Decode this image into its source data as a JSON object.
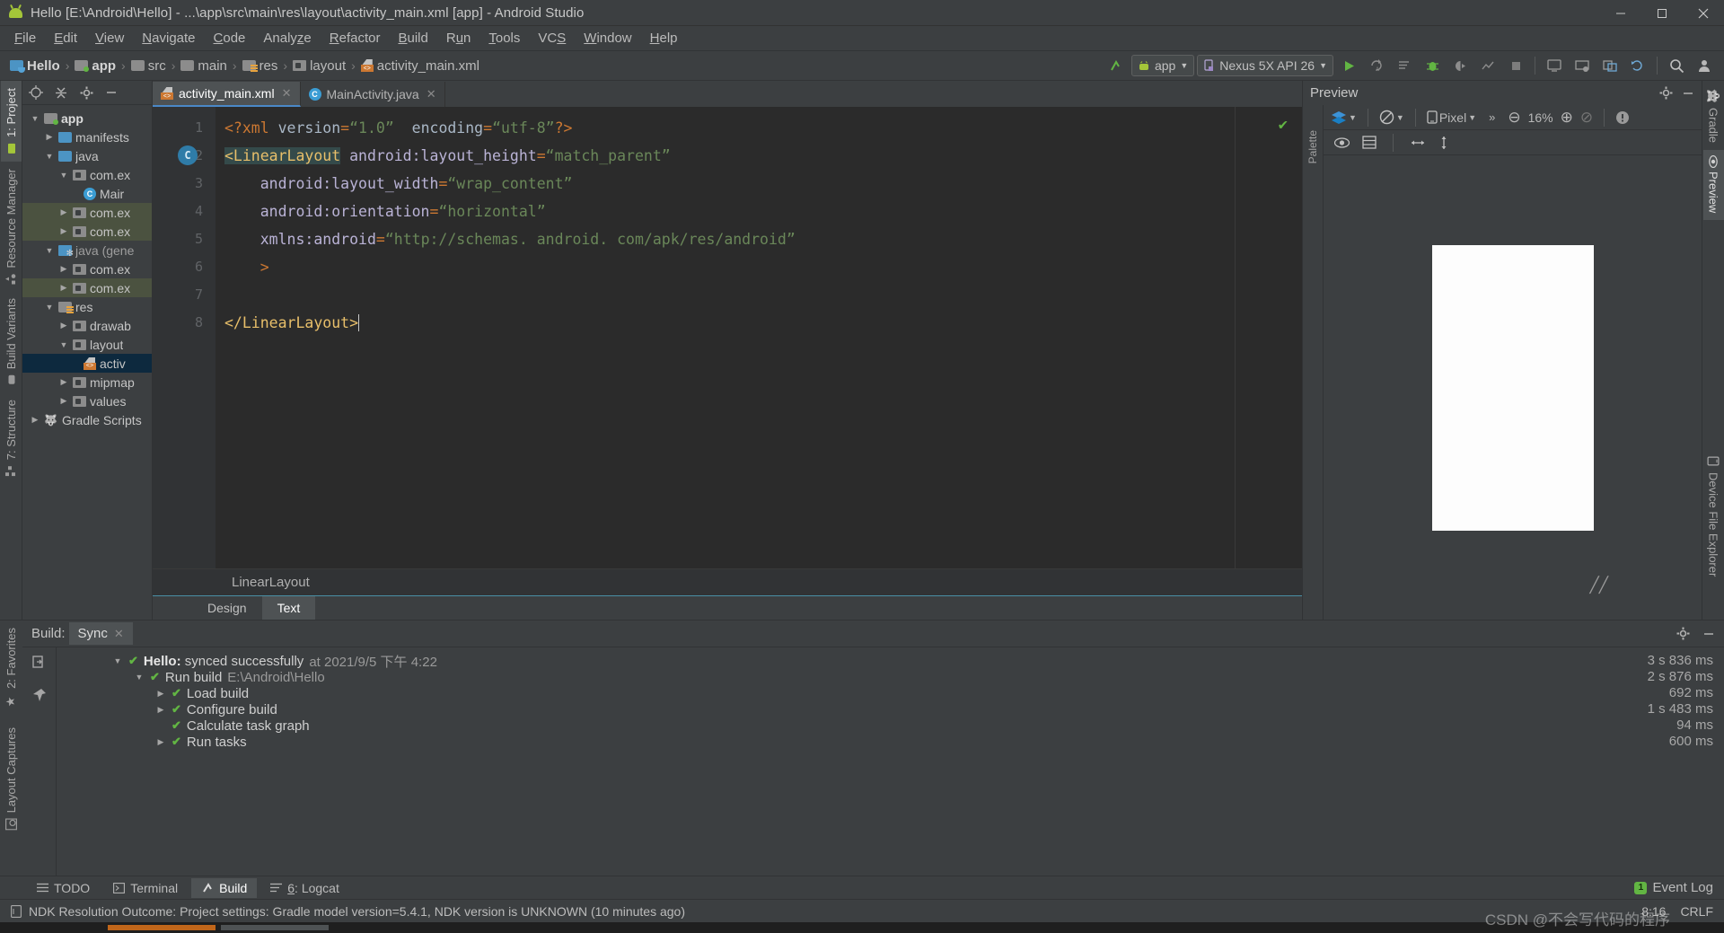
{
  "window": {
    "title": "Hello [E:\\Android\\Hello] - ...\\app\\src\\main\\res\\layout\\activity_main.xml [app] - Android Studio",
    "app_icon": "android-icon",
    "minimize": "—",
    "maximize": "❐",
    "close": "✕"
  },
  "menubar": {
    "items": [
      {
        "label": "File"
      },
      {
        "label": "Edit"
      },
      {
        "label": "View"
      },
      {
        "label": "Navigate"
      },
      {
        "label": "Code"
      },
      {
        "label": "Analyze"
      },
      {
        "label": "Refactor"
      },
      {
        "label": "Build"
      },
      {
        "label": "Run"
      },
      {
        "label": "Tools"
      },
      {
        "label": "VCS"
      },
      {
        "label": "Window"
      },
      {
        "label": "Help"
      }
    ]
  },
  "toolbar": {
    "breadcrumbs": [
      {
        "label": "Hello",
        "icon": "module-folder-icon"
      },
      {
        "label": "app",
        "icon": "app-folder-icon"
      },
      {
        "label": "src",
        "icon": "folder-icon"
      },
      {
        "label": "main",
        "icon": "folder-icon"
      },
      {
        "label": "res",
        "icon": "res-folder-icon"
      },
      {
        "label": "layout",
        "icon": "package-folder-icon"
      },
      {
        "label": "activity_main.xml",
        "icon": "xml-layout-file-icon"
      }
    ],
    "separator": "›",
    "build_config": "app",
    "device": "Nexus 5X API 26",
    "icons": [
      "make-project-icon",
      "run-icon",
      "apply-changes-icon",
      "apply-code-changes-icon",
      "debug-icon",
      "run-coverage-icon",
      "profiler-icon",
      "stop-icon",
      "avd-manager-icon",
      "sdk-manager-icon",
      "layout-inspector-icon",
      "sync-gradle-icon",
      "search-icon",
      "user-icon"
    ]
  },
  "left_strip": {
    "tabs": [
      {
        "label": "1: Project",
        "icon": "project-icon",
        "selected": true
      },
      {
        "label": "Resource Manager",
        "icon": "resource-manager-icon",
        "selected": false
      },
      {
        "label": "Build Variants",
        "icon": "build-variants-icon",
        "selected": false
      },
      {
        "label": "7: Structure",
        "icon": "structure-icon",
        "selected": false
      },
      {
        "label": "2: Favorites",
        "icon": "star-icon",
        "selected": false
      },
      {
        "label": "Layout Captures",
        "icon": "layout-captures-icon",
        "selected": false
      }
    ]
  },
  "project_panel": {
    "header_icons": [
      "locate-icon",
      "collapse-all-icon",
      "settings-gear-icon",
      "hide-icon"
    ],
    "tree": [
      {
        "label": "app",
        "depth": 0,
        "arrow": "▼",
        "icon": "app-folder-icon",
        "bold": true,
        "state": "none"
      },
      {
        "label": "manifests",
        "depth": 1,
        "arrow": "▶",
        "icon": "folder-icon",
        "bold": false,
        "state": "none"
      },
      {
        "label": "java",
        "depth": 1,
        "arrow": "▼",
        "icon": "folder-icon",
        "bold": false,
        "state": "none"
      },
      {
        "label": "com.ex",
        "depth": 2,
        "arrow": "▼",
        "icon": "package-icon",
        "bold": false,
        "state": "none"
      },
      {
        "label": "Mair",
        "depth": 3,
        "arrow": "",
        "icon": "java-class-icon",
        "bold": false,
        "state": "none"
      },
      {
        "label": "com.ex",
        "depth": 2,
        "arrow": "▶",
        "icon": "package-icon",
        "bold": false,
        "state": "green"
      },
      {
        "label": "com.ex",
        "depth": 2,
        "arrow": "▶",
        "icon": "package-icon",
        "bold": false,
        "state": "green"
      },
      {
        "label": "java (gene",
        "depth": 1,
        "arrow": "▼",
        "icon": "generated-folder-icon",
        "bold": false,
        "state": "none"
      },
      {
        "label": "com.ex",
        "depth": 2,
        "arrow": "▶",
        "icon": "package-icon",
        "bold": false,
        "state": "none"
      },
      {
        "label": "com.ex",
        "depth": 2,
        "arrow": "▶",
        "icon": "package-icon",
        "bold": false,
        "state": "green"
      },
      {
        "label": "res",
        "depth": 1,
        "arrow": "▼",
        "icon": "res-folder-icon",
        "bold": false,
        "state": "none"
      },
      {
        "label": "drawab",
        "depth": 2,
        "arrow": "▶",
        "icon": "package-icon",
        "bold": false,
        "state": "none"
      },
      {
        "label": "layout",
        "depth": 2,
        "arrow": "▼",
        "icon": "package-icon",
        "bold": false,
        "state": "none"
      },
      {
        "label": "activ",
        "depth": 3,
        "arrow": "",
        "icon": "xml-layout-file-icon",
        "bold": false,
        "state": "selected"
      },
      {
        "label": "mipmap",
        "depth": 2,
        "arrow": "▶",
        "icon": "package-icon",
        "bold": false,
        "state": "none"
      },
      {
        "label": "values",
        "depth": 2,
        "arrow": "▶",
        "icon": "package-icon",
        "bold": false,
        "state": "none"
      },
      {
        "label": "Gradle Scripts",
        "depth": 0,
        "arrow": "▶",
        "icon": "gradle-icon",
        "bold": false,
        "state": "none"
      }
    ]
  },
  "editor": {
    "tabs": [
      {
        "label": "activity_main.xml",
        "icon": "xml-layout-file-icon",
        "active": true,
        "close": "✕"
      },
      {
        "label": "MainActivity.java",
        "icon": "java-class-icon",
        "active": false,
        "close": "✕"
      }
    ],
    "line_numbers": [
      "1",
      "2",
      "3",
      "4",
      "5",
      "6",
      "7",
      "8"
    ],
    "gutter_class_marker": "C",
    "lines": [
      {
        "n": 1,
        "tokens": [
          {
            "t": "<?xml ",
            "c": "punc"
          },
          {
            "t": "version",
            "c": "plain"
          },
          {
            "t": "=",
            "c": "punc"
          },
          {
            "t": "“1.0”",
            "c": "str"
          },
          {
            "t": "  ",
            "c": "plain"
          },
          {
            "t": "encoding",
            "c": "plain"
          },
          {
            "t": "=",
            "c": "punc"
          },
          {
            "t": "“utf-8”",
            "c": "str"
          },
          {
            "t": "?>",
            "c": "punc"
          }
        ]
      },
      {
        "n": 2,
        "tokens": [
          {
            "t": "<LinearLayout",
            "c": "tag-sel"
          },
          {
            "t": " ",
            "c": "plain"
          },
          {
            "t": "android:layout_height",
            "c": "attr"
          },
          {
            "t": "=",
            "c": "punc"
          },
          {
            "t": "“match_parent”",
            "c": "str"
          }
        ]
      },
      {
        "n": 3,
        "tokens": [
          {
            "t": "    ",
            "c": "plain"
          },
          {
            "t": "android:layout_width",
            "c": "attr"
          },
          {
            "t": "=",
            "c": "punc"
          },
          {
            "t": "“wrap_content”",
            "c": "str"
          }
        ]
      },
      {
        "n": 4,
        "tokens": [
          {
            "t": "    ",
            "c": "plain"
          },
          {
            "t": "android:orientation",
            "c": "attr"
          },
          {
            "t": "=",
            "c": "punc"
          },
          {
            "t": "“horizontal”",
            "c": "str"
          }
        ]
      },
      {
        "n": 5,
        "tokens": [
          {
            "t": "    ",
            "c": "plain"
          },
          {
            "t": "xmlns:android",
            "c": "attr"
          },
          {
            "t": "=",
            "c": "punc"
          },
          {
            "t": "“http://schemas. android. com/apk/res/android”",
            "c": "str"
          }
        ]
      },
      {
        "n": 6,
        "tokens": [
          {
            "t": "    >",
            "c": "tag"
          }
        ]
      },
      {
        "n": 7,
        "tokens": []
      },
      {
        "n": 8,
        "tokens": [
          {
            "t": "</LinearLayout>",
            "c": "tag"
          }
        ]
      }
    ],
    "inspection_status": "✔",
    "breadcrumb": "LinearLayout",
    "design_tabs": [
      {
        "label": "Design",
        "active": false
      },
      {
        "label": "Text",
        "active": true
      }
    ]
  },
  "preview": {
    "title": "Preview",
    "header_icons": [
      "settings-gear-icon",
      "hide-icon"
    ],
    "palette_label": "Palette",
    "toolbar": {
      "theme_icon": "layers-icon",
      "orientation_icon": "rotate-icon",
      "device_icon": "phone-icon",
      "device_label": "Pixel",
      "overflow": "»",
      "zoom_out": "⊖",
      "zoom_level": "16%",
      "zoom_in": "⊕",
      "zoom_fit": "⊘",
      "issues_icon": "warning-icon"
    },
    "toolbar2_icons": [
      "eye-icon",
      "blueprint-icon",
      "horizontal-arrows-icon",
      "vertical-arrows-icon"
    ],
    "resize_handle": "╱╱"
  },
  "right_strip": {
    "tabs": [
      {
        "label": "Gradle",
        "icon": "gradle-icon",
        "selected": false
      },
      {
        "label": "Preview",
        "icon": "eye-icon",
        "selected": true
      },
      {
        "label": "Device File Explorer",
        "icon": "phone-icon",
        "selected": false
      }
    ]
  },
  "build_panel": {
    "label": "Build:",
    "tab": "Sync",
    "tab_close": "✕",
    "header_icons": [
      "settings-gear-icon",
      "hide-icon"
    ],
    "side_icons": [
      "restart-icon",
      "pin-icon"
    ],
    "rows": [
      {
        "depth": 0,
        "arrow": "▼",
        "check": "✔",
        "text": "Hello: synced successfully",
        "bold_part": "Hello:",
        "sub": "at 2021/9/5 下午 4:22",
        "time": "3 s 836 ms"
      },
      {
        "depth": 1,
        "arrow": "▼",
        "check": "✔",
        "text": "Run build",
        "bold_part": "",
        "sub": "E:\\Android\\Hello",
        "time": "2 s 876 ms"
      },
      {
        "depth": 2,
        "arrow": "▶",
        "check": "✔",
        "text": "Load build",
        "bold_part": "",
        "sub": "",
        "time": "692 ms"
      },
      {
        "depth": 2,
        "arrow": "▶",
        "check": "✔",
        "text": "Configure build",
        "bold_part": "",
        "sub": "",
        "time": "1 s 483 ms"
      },
      {
        "depth": 2,
        "arrow": "",
        "check": "✔",
        "text": "Calculate task graph",
        "bold_part": "",
        "sub": "",
        "time": "94 ms"
      },
      {
        "depth": 2,
        "arrow": "▶",
        "check": "✔",
        "text": "Run tasks",
        "bold_part": "",
        "sub": "",
        "time": "600 ms"
      }
    ]
  },
  "bottom_tabs": {
    "items": [
      {
        "label": "TODO",
        "icon": "todo-icon",
        "active": false
      },
      {
        "label": "Terminal",
        "icon": "terminal-icon",
        "active": false
      },
      {
        "label": "Build",
        "icon": "build-hammer-icon",
        "active": true
      },
      {
        "label": "6: Logcat",
        "icon": "logcat-icon",
        "active": false
      }
    ],
    "event_log": {
      "badge": "1",
      "label": "Event Log"
    }
  },
  "statusbar": {
    "icon": "document-icon",
    "message": "NDK Resolution Outcome: Project settings: Gradle model version=5.4.1, NDK version is UNKNOWN (10 minutes ago)",
    "position": "8:16",
    "encoding": "CRLF",
    "watermark": "CSDN @不会写代码的程序"
  },
  "colors": {
    "bg": "#3c3f41",
    "editor_bg": "#2b2b2b",
    "accent": "#4a88c7",
    "green": "#62b543",
    "selected_tree": "#0d293e",
    "string": "#6a8759",
    "tag": "#e8bf6a",
    "attr": "#bab3d6"
  }
}
